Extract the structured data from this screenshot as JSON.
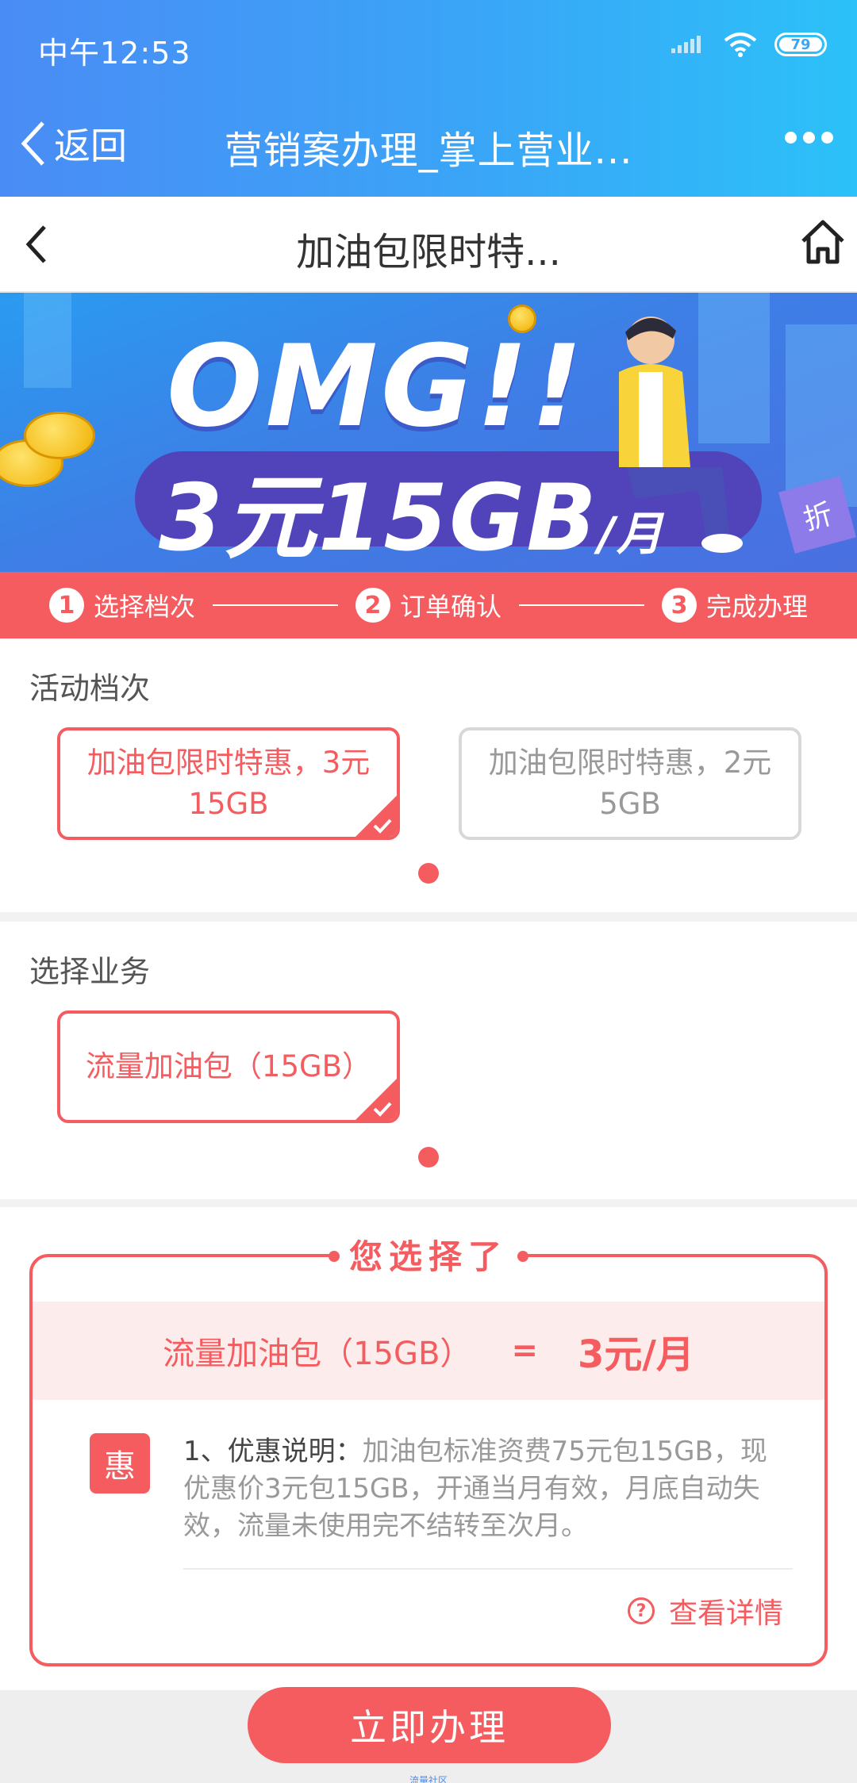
{
  "status_bar": {
    "time": "中午12:53",
    "battery": "79"
  },
  "nav": {
    "back_label": "返回",
    "title": "营销案办理_掌上营业..."
  },
  "page": {
    "title": "加油包限时特..."
  },
  "banner": {
    "headline": "OMG!!",
    "price": "3元15GB",
    "unit": "/月",
    "tag": "折"
  },
  "steps": [
    {
      "num": "1",
      "label": "选择档次"
    },
    {
      "num": "2",
      "label": "订单确认"
    },
    {
      "num": "3",
      "label": "完成办理"
    }
  ],
  "activity": {
    "title": "活动档次",
    "options": [
      {
        "line1": "加油包限时特惠，3元",
        "line2": "15GB",
        "selected": true
      },
      {
        "line1": "加油包限时特惠，2元",
        "line2": "5GB",
        "selected": false
      }
    ]
  },
  "service": {
    "title": "选择业务",
    "options": [
      {
        "label": "流量加油包（15GB）",
        "selected": true
      }
    ]
  },
  "summary": {
    "title": "您选择了",
    "item": "流量加油包（15GB）",
    "equals": "=",
    "price": "3元/月",
    "badge": "惠",
    "desc_label": "1、优惠说明：",
    "desc_text": "加油包标准资费75元包15GB，现优惠价3元包15GB，开通当月有效，月底自动失效，流量未使用完不结转至次月。",
    "details_label": "查看详情"
  },
  "cta": {
    "label": "立即办理"
  },
  "watermark": "流量社区",
  "colors": {
    "accent": "#f45c5f",
    "header_start": "#4a8cf5",
    "header_end": "#2cc1f8"
  }
}
